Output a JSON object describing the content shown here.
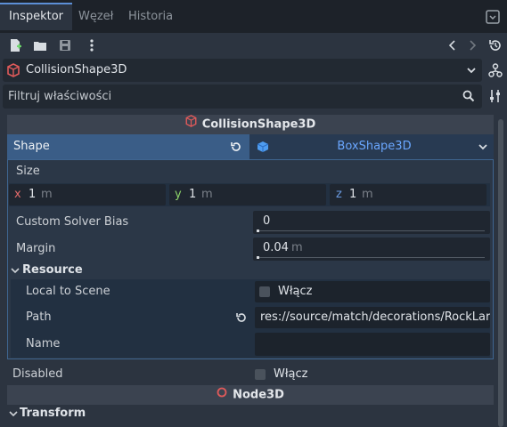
{
  "tabs": [
    {
      "label": "Inspektor",
      "active": true
    },
    {
      "label": "Węzeł",
      "active": false
    },
    {
      "label": "Historia",
      "active": false
    }
  ],
  "node": {
    "name": "CollisionShape3D"
  },
  "filter": {
    "placeholder": "Filtruj właściwości"
  },
  "sections": {
    "collision": "CollisionShape3D",
    "node3d": "Node3D",
    "transform": "Transform"
  },
  "shape": {
    "label": "Shape",
    "value": "BoxShape3D"
  },
  "size": {
    "label": "Size",
    "x": {
      "axis": "x",
      "value": "1",
      "unit": "m"
    },
    "y": {
      "axis": "y",
      "value": "1",
      "unit": "m"
    },
    "z": {
      "axis": "z",
      "value": "1",
      "unit": "m"
    }
  },
  "solver_bias": {
    "label": "Custom Solver Bias",
    "value": "0"
  },
  "margin": {
    "label": "Margin",
    "value": "0.04",
    "unit": "m"
  },
  "resource": {
    "label": "Resource",
    "local_to_scene": {
      "label": "Local to Scene",
      "check": "Włącz"
    },
    "path": {
      "label": "Path",
      "value": "res://source/match/decorations/RockLarg"
    },
    "name": {
      "label": "Name",
      "value": ""
    }
  },
  "disabled": {
    "label": "Disabled",
    "check": "Włącz"
  },
  "colors": {
    "accent": "#5c8fd6",
    "selected_row": "#3a5d87",
    "resource_link": "#6aa7ff",
    "node_icon": "#e05a5a"
  }
}
